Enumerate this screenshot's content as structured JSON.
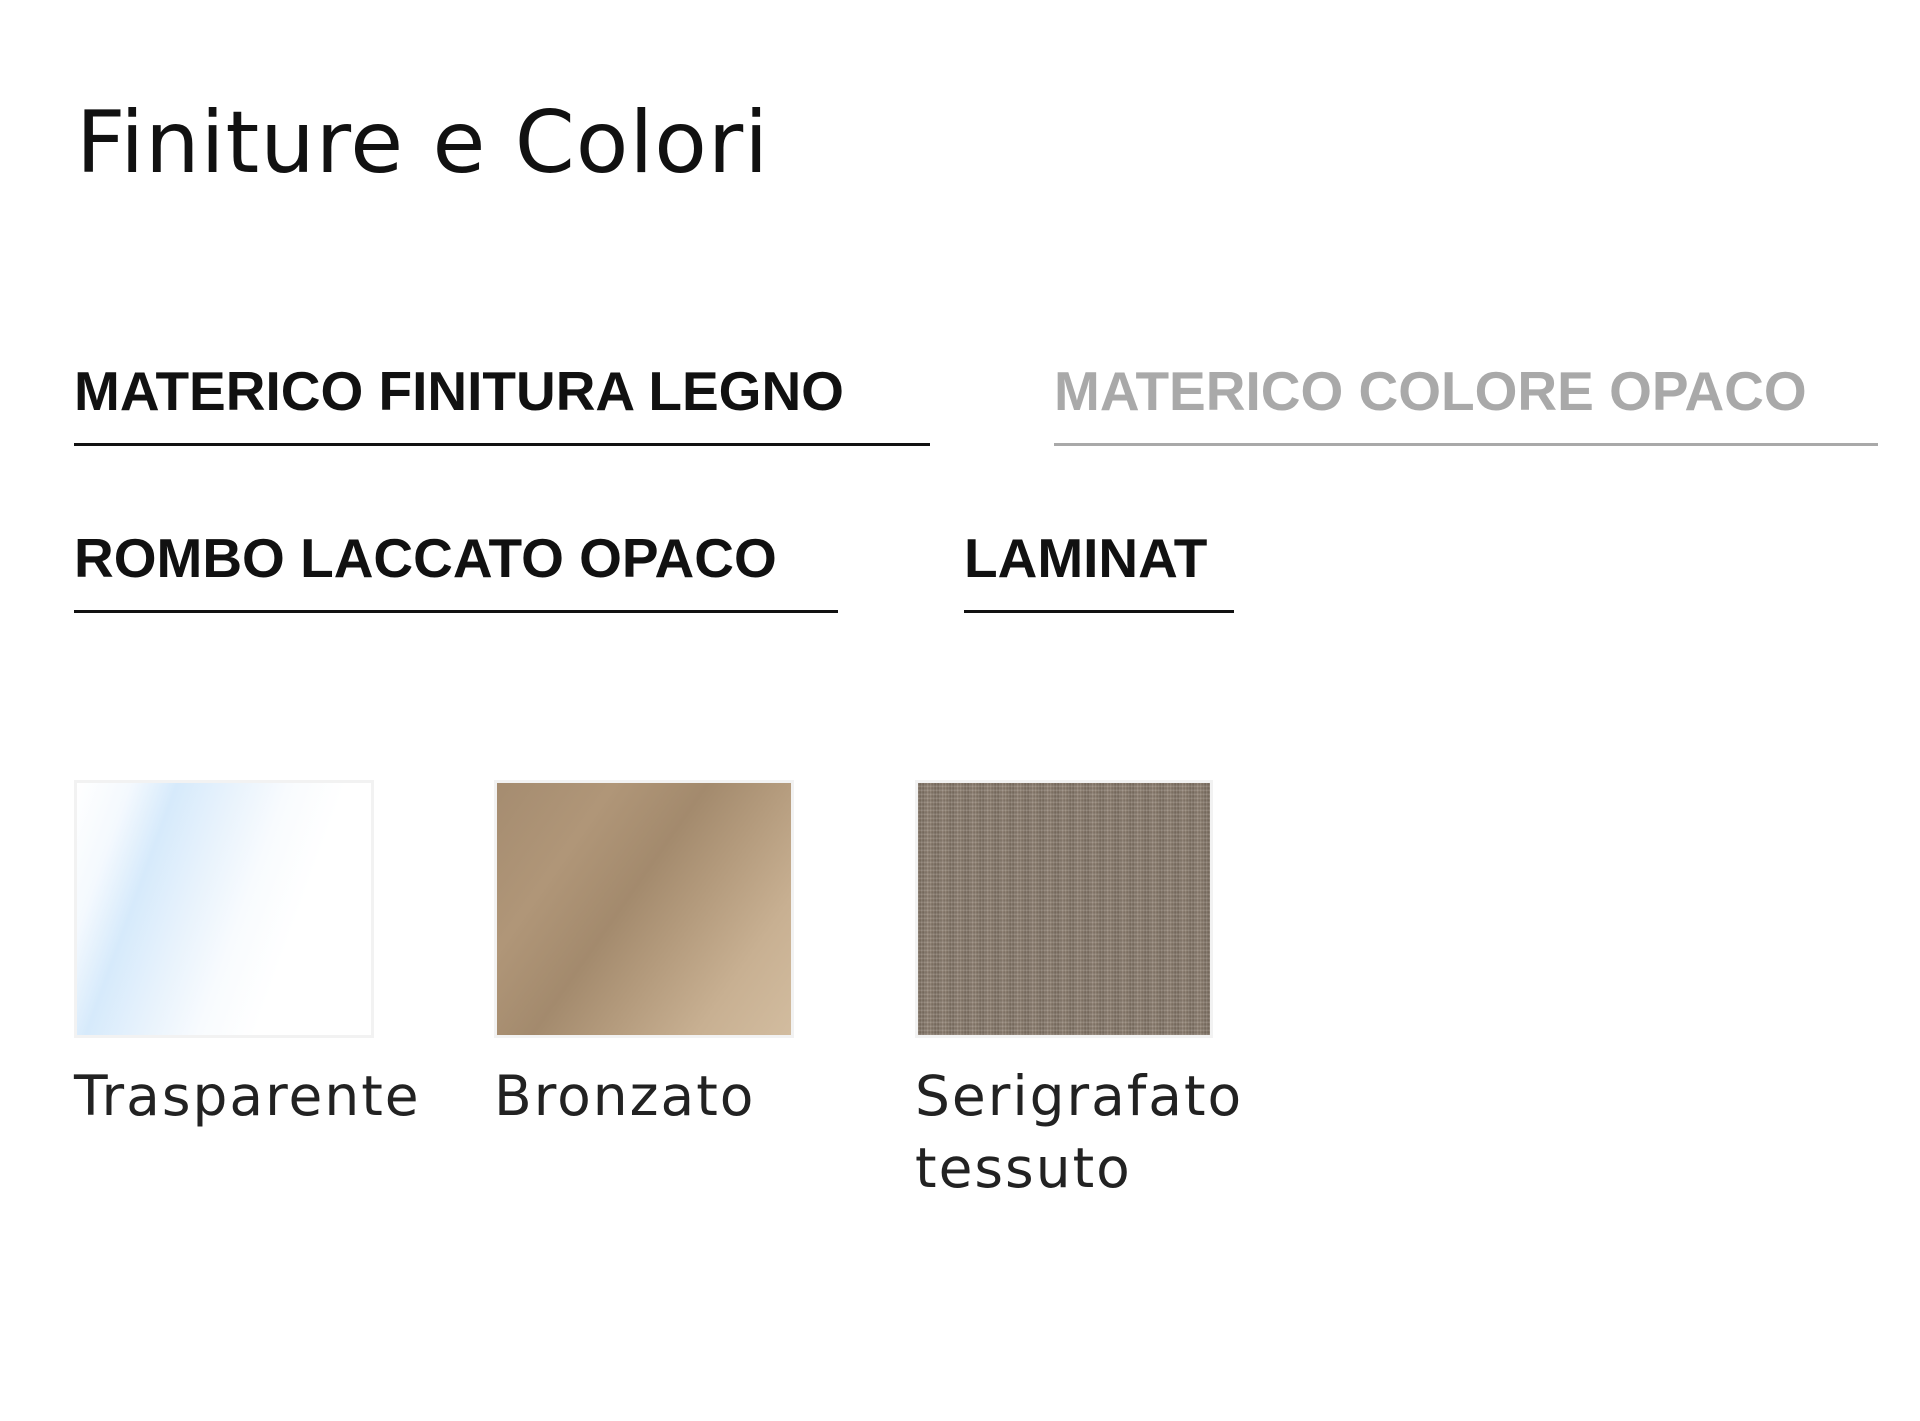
{
  "title": "Finiture e Colori",
  "tabs": [
    {
      "label": "MATERICO FINITURA LEGNO",
      "state": "active"
    },
    {
      "label": "MATERICO COLORE OPACO",
      "state": "inactive"
    },
    {
      "label": "ROMBO LACCATO OPACO",
      "state": "active"
    },
    {
      "label": "LAMINAT",
      "state": "active"
    }
  ],
  "swatches": [
    {
      "label": "Trasparente",
      "finish": "transparent glass",
      "color": "#d6eafb"
    },
    {
      "label": "Bronzato",
      "finish": "bronze glass",
      "color": "#b09678"
    },
    {
      "label": "Serigrafato tessuto",
      "finish": "fabric texture",
      "color": "#8a7b6c"
    }
  ],
  "colors": {
    "text": "#111111",
    "inactive_tab": "#a9a9a9"
  }
}
